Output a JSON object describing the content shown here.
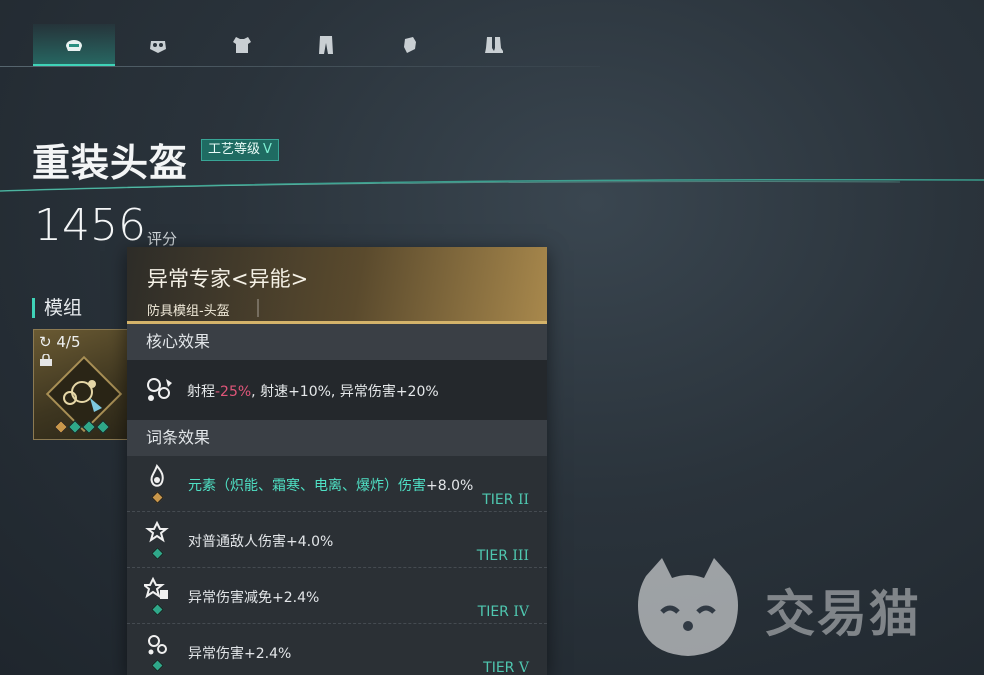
{
  "equipment_slots": [
    {
      "icon": "helmet-icon",
      "active": true
    },
    {
      "icon": "mask-icon",
      "active": false
    },
    {
      "icon": "chest-armor-icon",
      "active": false
    },
    {
      "icon": "pants-icon",
      "active": false
    },
    {
      "icon": "gloves-icon",
      "active": false
    },
    {
      "icon": "boots-icon",
      "active": false
    }
  ],
  "item": {
    "name": "重装头盔",
    "craft_label": "工艺等级",
    "craft_level": "V",
    "score": "1456",
    "score_label": "评分"
  },
  "module_section": {
    "title": "模组",
    "count": "4/5"
  },
  "tooltip": {
    "name": "异常专家<异能>",
    "subtitle": "防具模组-头盔",
    "core_title": "核心效果",
    "core_effect": {
      "prefix": "射程",
      "negative": "-25%",
      "rest": ", 射速+10%, 异常伤害+20%"
    },
    "affix_title": "词条效果",
    "affixes": [
      {
        "text": "元素（炽能、霜寒、电离、爆炸）伤害",
        "value": "+8.0%",
        "tier_prefix": "TIER",
        "tier_roman": "II",
        "gem": "gold",
        "highlight": true
      },
      {
        "text": "对普通敌人伤害+4.0%",
        "value": "",
        "tier_prefix": "TIER",
        "tier_roman": "III",
        "gem": "green",
        "highlight": false
      },
      {
        "text": "异常伤害减免+2.4%",
        "value": "",
        "tier_prefix": "TIER",
        "tier_roman": "IV",
        "gem": "green",
        "highlight": false
      },
      {
        "text": "异常伤害+2.4%",
        "value": "",
        "tier_prefix": "TIER",
        "tier_roman": "V",
        "gem": "green",
        "highlight": false
      }
    ]
  },
  "colors": {
    "accent_teal": "#3fd3b8",
    "negative_pink": "#e0567a",
    "gold": "#d4b36a"
  },
  "watermark": {
    "text": "交易猫"
  }
}
